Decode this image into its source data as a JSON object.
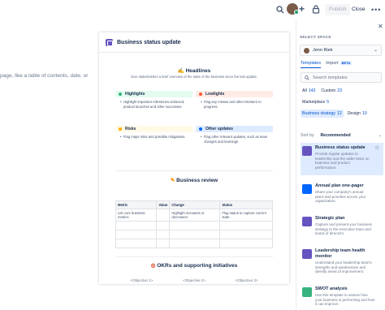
{
  "topbar": {
    "publish_label": "Publish",
    "close_label": "Close",
    "more_label": "•••"
  },
  "left_hint": "page, like a table of contents, date, or",
  "document": {
    "title": "Business status update",
    "headlines": {
      "heading": "Headlines",
      "subtitle": "Give stakeholders a brief overview of the state of the business since the last update."
    },
    "panels": [
      {
        "title": "Highlights",
        "color": "#36b37e",
        "bar": "#e3fcef",
        "items": [
          "Highlight important milestones achieved,",
          "product launches and other successes."
        ]
      },
      {
        "title": "Lowlights",
        "color": "#ff5630",
        "bar": "#ffebe6",
        "items": [
          "Flag any misses and other blockers to",
          "progress."
        ]
      },
      {
        "title": "Risks",
        "color": "#ffab00",
        "bar": "#fffae6",
        "items": [
          "Flag major risks and possible mitigations."
        ]
      },
      {
        "title": "Other updates",
        "color": "#0065ff",
        "bar": "#deebff",
        "items": [
          "Flag other relevant updates, such as team",
          "changes and learnings."
        ]
      }
    ],
    "business_review": {
      "heading": "Business review"
    },
    "table": {
      "headers": [
        "Metric",
        "Value",
        "Change",
        "Status"
      ],
      "rows": [
        [
          "List core business metrics.",
          "",
          "Highlight increases or decreases.",
          "Flag status to capture current state."
        ],
        [
          "",
          "",
          "",
          ""
        ],
        [
          "",
          "",
          "",
          ""
        ],
        [
          "",
          "",
          "",
          ""
        ]
      ]
    },
    "okrs": {
      "heading": "OKRs and supporting initiatives"
    },
    "objectives": [
      "<Objective 1>",
      "<Objective 2>",
      "<Objective 3>"
    ]
  },
  "right_panel": {
    "close_label": "✕",
    "select_space_label": "SELECT SPACE",
    "space_name": "Jenn Riek",
    "tabs": [
      {
        "label": "Templates",
        "active": true
      },
      {
        "label": "Import",
        "badge": "BETA",
        "active": false
      }
    ],
    "search_placeholder": "Search templates",
    "chips": [
      {
        "label": "All",
        "count": "143",
        "active": false
      },
      {
        "label": "Custom",
        "count": "23",
        "active": false
      },
      {
        "label": "Marketplace",
        "count": "5",
        "active": false
      },
      {
        "label": "Business strategy",
        "count": "12",
        "active": true
      },
      {
        "label": "Design",
        "count": "10",
        "active": false
      }
    ],
    "sort_label": "Sort by",
    "sort_value": "Recommended",
    "templates": [
      {
        "title": "Business status update",
        "desc": [
          "Provide regular updates to",
          "leadership and the wider team on",
          "business and product",
          "performance."
        ],
        "color": "#6554c0",
        "selected": true
      },
      {
        "title": "Annual plan one-pager",
        "desc": [
          "Share your company's annual",
          "plans and priorities across your",
          "organization."
        ],
        "color": "#0065ff",
        "selected": false
      },
      {
        "title": "Strategic plan",
        "desc": [
          "Capture and present your business",
          "strategy to the executive team and",
          "board of directors."
        ],
        "color": "#6554c0",
        "selected": false
      },
      {
        "title": "Leadership team health monitor",
        "desc": [
          "Understand your leadership team's",
          "strengths and weaknesses and",
          "identify areas of improvement."
        ],
        "color": "#6554c0",
        "selected": false
      },
      {
        "title": "SWOT analysis",
        "desc": [
          "Use this template to assess how",
          "your business is performing and how",
          "it can improve."
        ],
        "color": "#36b37e",
        "selected": false
      }
    ]
  }
}
